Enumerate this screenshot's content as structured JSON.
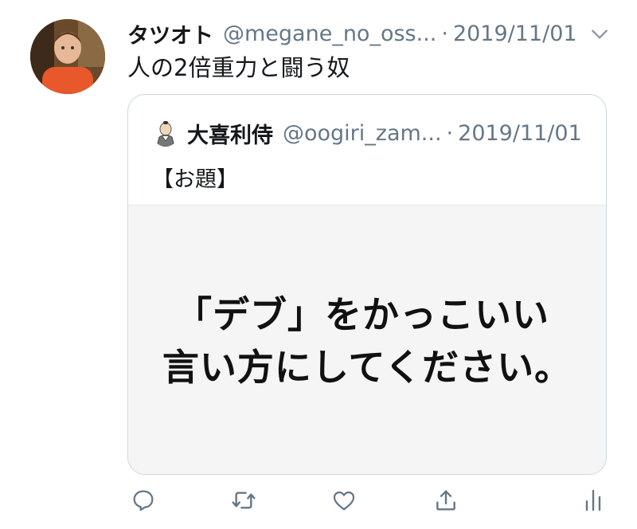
{
  "tweet": {
    "display_name": "タツオト",
    "handle": "@megane_no_oss...",
    "separator": "·",
    "date": "2019/11/01",
    "text": "人の2倍重力と闘う奴"
  },
  "quoted_tweet": {
    "display_name": "大喜利侍",
    "handle": "@oogiri_zam...",
    "separator": "·",
    "date": "2019/11/01",
    "text": "【お題】",
    "media_text": {
      "line1": "「デブ」をかっこいい",
      "line2": "言い方にしてください。"
    }
  },
  "icons": {
    "more": "chevron-down-icon",
    "reply": "reply-icon",
    "retweet": "retweet-icon",
    "like": "heart-icon",
    "share": "share-icon",
    "analytics": "analytics-icon"
  },
  "colors": {
    "text": "#14171a",
    "secondary": "#657786",
    "border": "#ccd6dd",
    "icon": "#657786"
  }
}
